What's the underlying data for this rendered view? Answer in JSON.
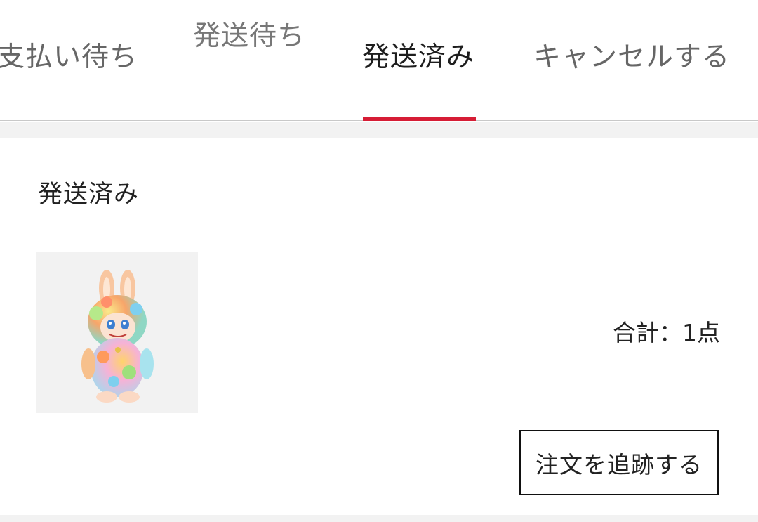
{
  "tabs": [
    {
      "label": "支払い待ち",
      "active": false
    },
    {
      "label": "発送待ち",
      "active": false
    },
    {
      "label": "発送済み",
      "active": true
    },
    {
      "label": "キャンセルする",
      "active": false
    }
  ],
  "colors": {
    "accent": "#d61d35",
    "divider": "#f2f2f2"
  },
  "order": {
    "status": "発送済み",
    "product_image": "labubu-figure",
    "total_label": "合計：",
    "total_count": "1点",
    "track_button": "注文を追跡する"
  }
}
